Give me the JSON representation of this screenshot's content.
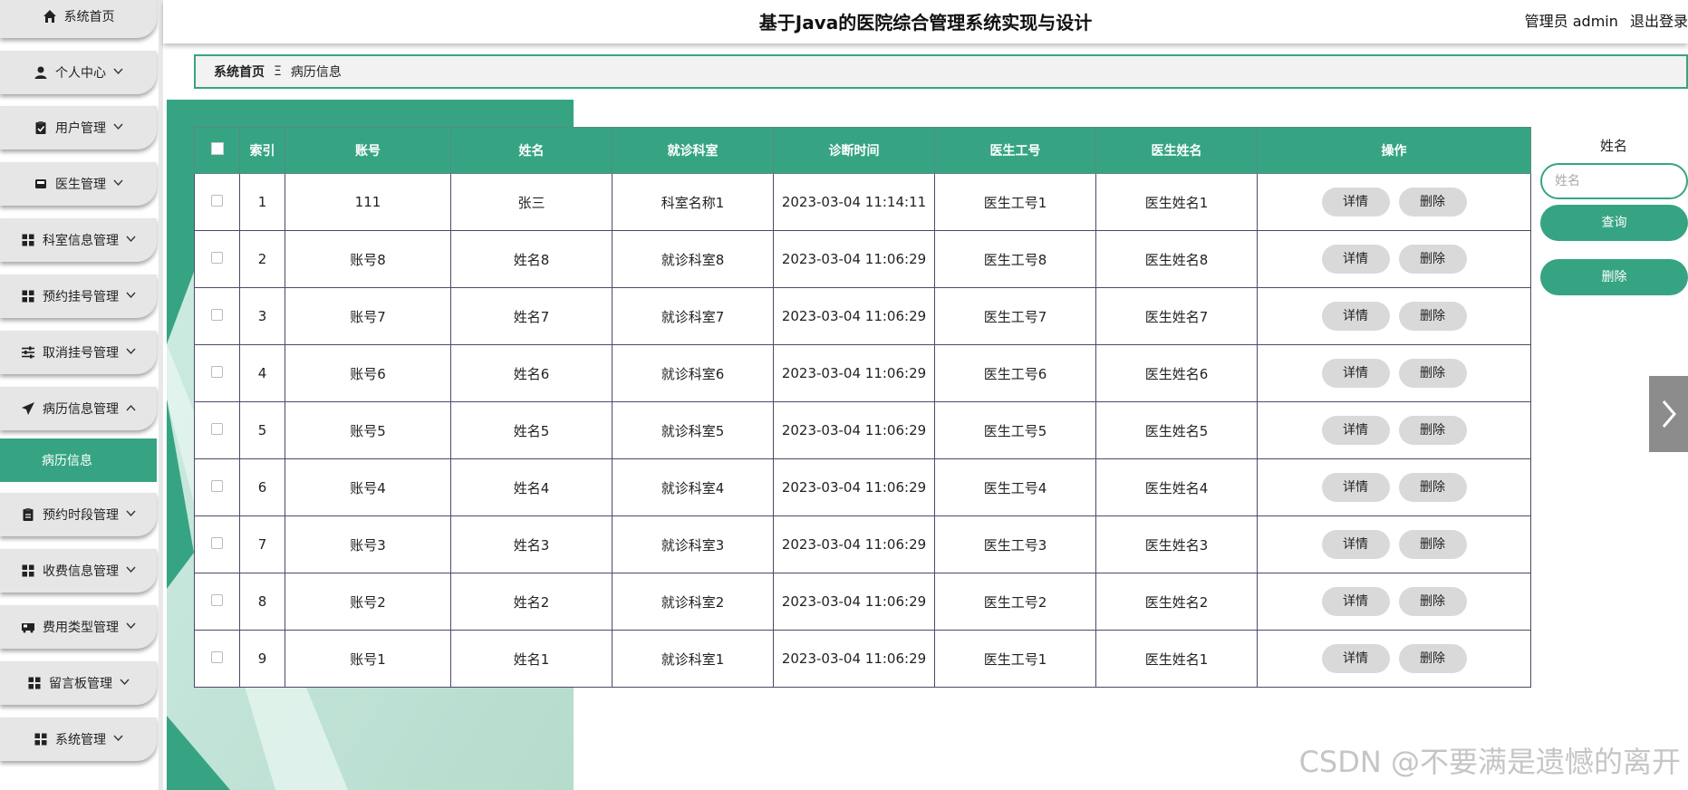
{
  "header": {
    "title": "基于Java的医院综合管理系统实现与设计",
    "user": "管理员 admin",
    "logout": "退出登录"
  },
  "sidebar": {
    "items": [
      {
        "label": "系统首页",
        "icon": "home-icon",
        "chevron": false
      },
      {
        "label": "个人中心",
        "icon": "user-icon",
        "chevron": true
      },
      {
        "label": "用户管理",
        "icon": "clipboard-check-icon",
        "chevron": true
      },
      {
        "label": "医生管理",
        "icon": "inbox-icon",
        "chevron": true
      },
      {
        "label": "科室信息管理",
        "icon": "grid-icon",
        "chevron": true
      },
      {
        "label": "预约挂号管理",
        "icon": "grid-icon",
        "chevron": true
      },
      {
        "label": "取消挂号管理",
        "icon": "sliders-icon",
        "chevron": true
      },
      {
        "label": "病历信息管理",
        "icon": "paper-plane-icon",
        "chevron": true,
        "expanded": true
      },
      {
        "label": "预约时段管理",
        "icon": "clipboard-icon",
        "chevron": true
      },
      {
        "label": "收费信息管理",
        "icon": "grid-icon",
        "chevron": true
      },
      {
        "label": "费用类型管理",
        "icon": "bus-icon",
        "chevron": true
      },
      {
        "label": "留言板管理",
        "icon": "grid-icon",
        "chevron": true
      },
      {
        "label": "系统管理",
        "icon": "grid-icon",
        "chevron": true
      }
    ],
    "active_sub": "病历信息"
  },
  "breadcrumb": {
    "home": "系统首页",
    "separator": "Ξ",
    "current": "病历信息"
  },
  "table": {
    "columns": [
      "索引",
      "账号",
      "姓名",
      "就诊科室",
      "诊断时间",
      "医生工号",
      "医生姓名",
      "操作"
    ],
    "rows": [
      {
        "index": "1",
        "account": "111",
        "name": "张三",
        "dept": "科室名称1",
        "time": "2023-03-04 11:14:11",
        "doc_id": "医生工号1",
        "doc_name": "医生姓名1"
      },
      {
        "index": "2",
        "account": "账号8",
        "name": "姓名8",
        "dept": "就诊科室8",
        "time": "2023-03-04 11:06:29",
        "doc_id": "医生工号8",
        "doc_name": "医生姓名8"
      },
      {
        "index": "3",
        "account": "账号7",
        "name": "姓名7",
        "dept": "就诊科室7",
        "time": "2023-03-04 11:06:29",
        "doc_id": "医生工号7",
        "doc_name": "医生姓名7"
      },
      {
        "index": "4",
        "account": "账号6",
        "name": "姓名6",
        "dept": "就诊科室6",
        "time": "2023-03-04 11:06:29",
        "doc_id": "医生工号6",
        "doc_name": "医生姓名6"
      },
      {
        "index": "5",
        "account": "账号5",
        "name": "姓名5",
        "dept": "就诊科室5",
        "time": "2023-03-04 11:06:29",
        "doc_id": "医生工号5",
        "doc_name": "医生姓名5"
      },
      {
        "index": "6",
        "account": "账号4",
        "name": "姓名4",
        "dept": "就诊科室4",
        "time": "2023-03-04 11:06:29",
        "doc_id": "医生工号4",
        "doc_name": "医生姓名4"
      },
      {
        "index": "7",
        "account": "账号3",
        "name": "姓名3",
        "dept": "就诊科室3",
        "time": "2023-03-04 11:06:29",
        "doc_id": "医生工号3",
        "doc_name": "医生姓名3"
      },
      {
        "index": "8",
        "account": "账号2",
        "name": "姓名2",
        "dept": "就诊科室2",
        "time": "2023-03-04 11:06:29",
        "doc_id": "医生工号2",
        "doc_name": "医生姓名2"
      },
      {
        "index": "9",
        "account": "账号1",
        "name": "姓名1",
        "dept": "就诊科室1",
        "time": "2023-03-04 11:06:29",
        "doc_id": "医生工号1",
        "doc_name": "医生姓名1"
      }
    ],
    "detail_label": "详情",
    "delete_label": "删除"
  },
  "search": {
    "label": "姓名",
    "placeholder": "姓名",
    "value": "",
    "query_label": "查询",
    "delete_label": "删除"
  },
  "watermark": "CSDN @不要满是遗憾的离开",
  "colors": {
    "accent": "#36a483",
    "sidebar_bg": "#e6e6e6",
    "button_gray": "#d9d9d9"
  }
}
